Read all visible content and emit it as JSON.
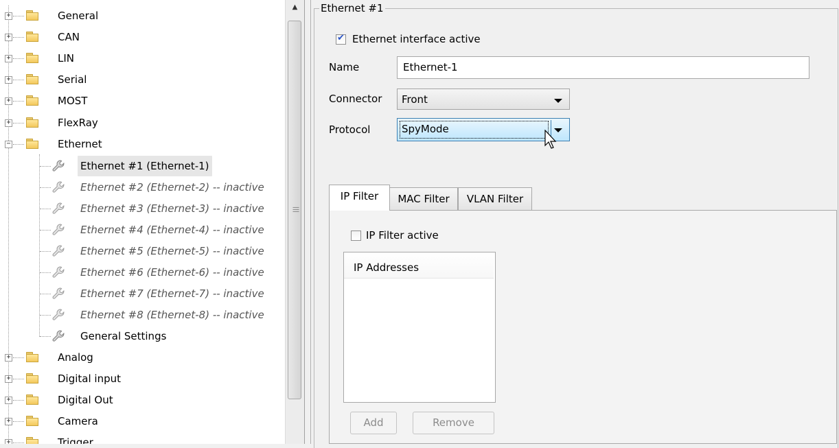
{
  "tree": {
    "categories_top": [
      "General",
      "CAN",
      "LIN",
      "Serial",
      "MOST",
      "FlexRay"
    ],
    "expanded_category": "Ethernet",
    "expanded_glyph": "−",
    "collapsed_glyph": "+",
    "ethernet_children": [
      {
        "label": "Ethernet #1 (Ethernet-1)",
        "inactive": false
      },
      {
        "label": "Ethernet #2 (Ethernet-2) -- inactive",
        "inactive": true
      },
      {
        "label": "Ethernet #3 (Ethernet-3) -- inactive",
        "inactive": true
      },
      {
        "label": "Ethernet #4 (Ethernet-4) -- inactive",
        "inactive": true
      },
      {
        "label": "Ethernet #5 (Ethernet-5) -- inactive",
        "inactive": true
      },
      {
        "label": "Ethernet #6 (Ethernet-6) -- inactive",
        "inactive": true
      },
      {
        "label": "Ethernet #7 (Ethernet-7) -- inactive",
        "inactive": true
      },
      {
        "label": "Ethernet #8 (Ethernet-8) -- inactive",
        "inactive": true
      },
      {
        "label": "General Settings",
        "inactive": false
      }
    ],
    "categories_bottom": [
      "Analog",
      "Digital input",
      "Digital Out",
      "Camera",
      "Trigger"
    ]
  },
  "panel": {
    "group_title": "Ethernet #1",
    "interface_active_label": "Ethernet interface active",
    "interface_active_checked": true,
    "name_label": "Name",
    "name_value": "Ethernet-1",
    "connector_label": "Connector",
    "connector_value": "Front",
    "protocol_label": "Protocol",
    "protocol_value": "SpyMode",
    "tabs": [
      "IP Filter",
      "MAC Filter",
      "VLAN Filter"
    ],
    "selected_tab": "IP Filter",
    "ip_filter_active_label": "IP Filter active",
    "ip_filter_active_checked": false,
    "ip_list_header": "IP Addresses",
    "add_button": "Add",
    "remove_button": "Remove"
  },
  "colors": {
    "folder": "#f3c85d",
    "checkmark": "#2b55c8",
    "combo_active": "#bee6fd"
  }
}
